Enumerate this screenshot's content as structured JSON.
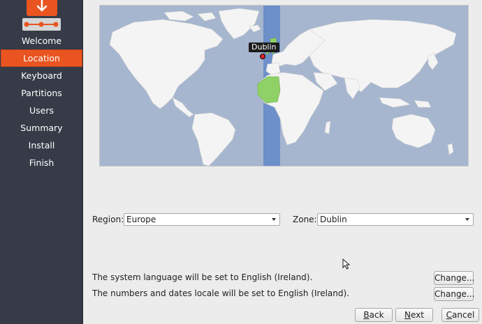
{
  "sidebar": {
    "items": [
      {
        "label": "Welcome",
        "active": false
      },
      {
        "label": "Location",
        "active": true
      },
      {
        "label": "Keyboard",
        "active": false
      },
      {
        "label": "Partitions",
        "active": false
      },
      {
        "label": "Users",
        "active": false
      },
      {
        "label": "Summary",
        "active": false
      },
      {
        "label": "Install",
        "active": false
      },
      {
        "label": "Finish",
        "active": false
      }
    ]
  },
  "map": {
    "selected_city": "Dublin"
  },
  "form": {
    "region_label": "Region:",
    "region_value": "Europe",
    "zone_label": "Zone:",
    "zone_value": "Dublin"
  },
  "locale": {
    "language_text": "The system language will be set to English (Ireland).",
    "numbers_text": "The numbers and dates locale will be set to English (Ireland).",
    "change_label": "Change..."
  },
  "buttons": {
    "back_first": "B",
    "back_rest": "ack",
    "next_first": "N",
    "next_rest": "ext",
    "cancel_first": "C",
    "cancel_rest": "ancel"
  },
  "colors": {
    "accent": "#e95420",
    "sidebar_bg": "#363b47",
    "map_ocean": "#a6b6cf",
    "timezone_band": "#6d8fca",
    "highlight_land": "#8fd167"
  }
}
